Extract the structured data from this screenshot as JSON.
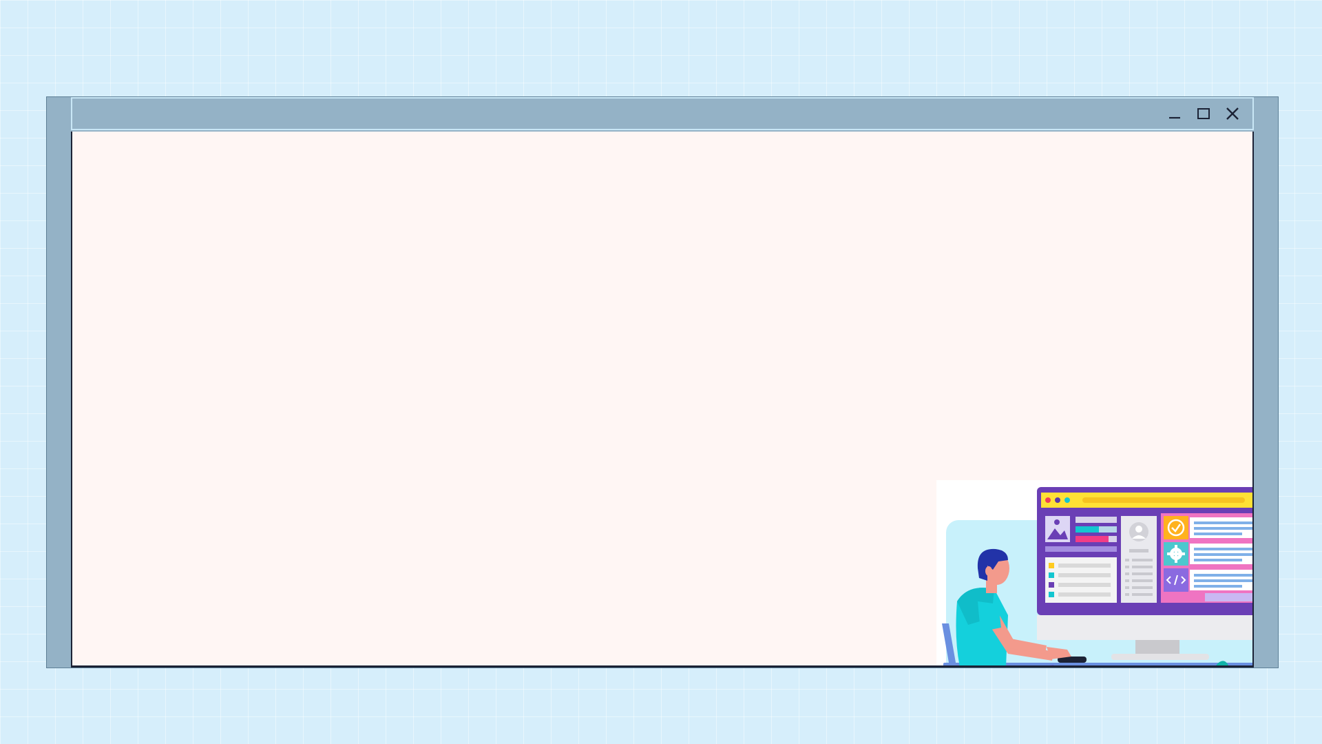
{
  "window": {
    "controls": [
      {
        "name": "minimize-button",
        "icon": "minimize-icon"
      },
      {
        "name": "maximize-button",
        "icon": "maximize-icon"
      },
      {
        "name": "close-button",
        "icon": "close-icon"
      }
    ]
  },
  "illustration": {
    "subject": "person-at-computer-illustration",
    "colors": {
      "monitor_frame": "#6a3fb5",
      "monitor_topbar": "#ffe135",
      "shirt": "#14d0dc",
      "pants": "#a9a3e6",
      "hair": "#2233a8",
      "plant": "#13c7b3",
      "pot": "#8e54d8",
      "desk": "#6a8fe0"
    }
  },
  "theme": {
    "background": "#d6eefb",
    "window_frame": "#94b2c6",
    "content_background": "#fff6f4"
  }
}
